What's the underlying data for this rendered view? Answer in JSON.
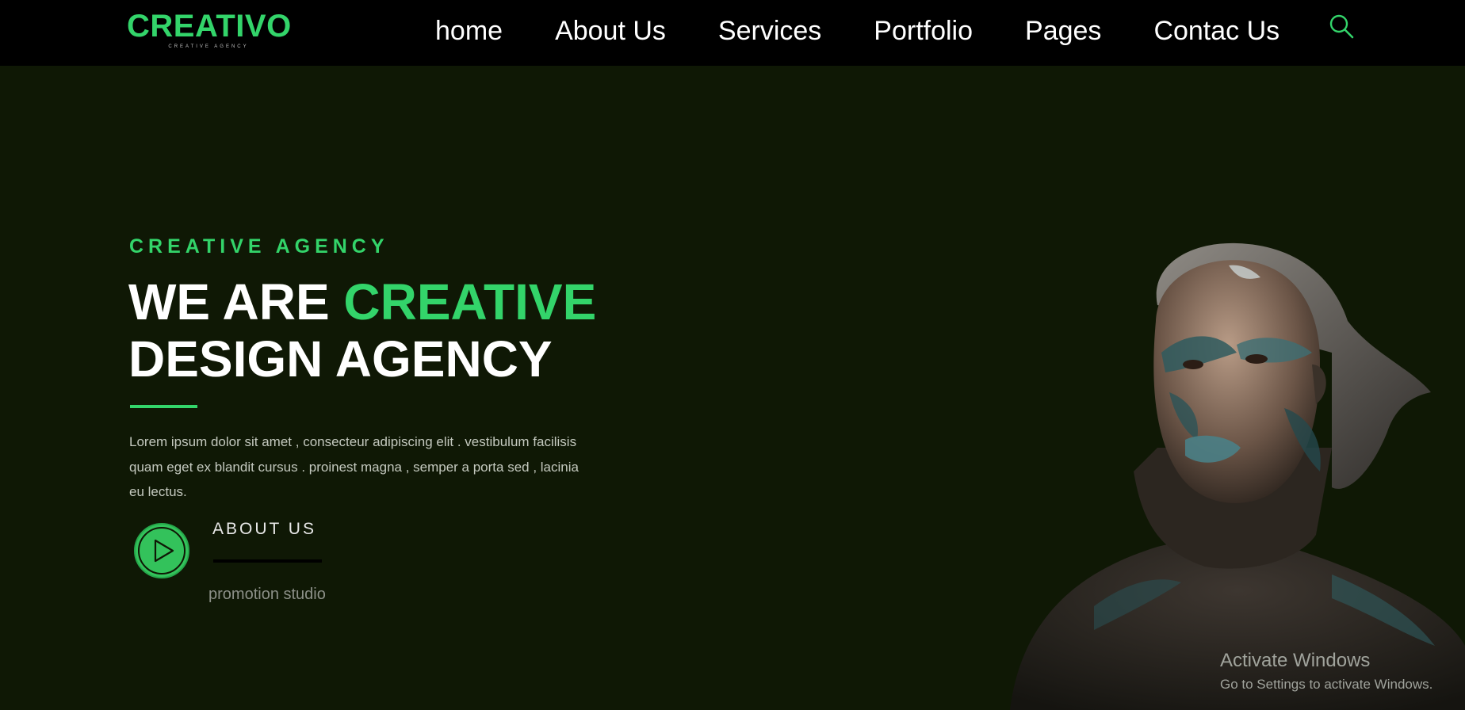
{
  "brand": {
    "name": "CREATIVO",
    "tagline": "CREATIVE AGENCY",
    "accent_color": "#33d46a",
    "background_color": "#0f1805",
    "nav_background": "#000000"
  },
  "nav": {
    "items": [
      {
        "label": "home"
      },
      {
        "label": "About Us"
      },
      {
        "label": "Services"
      },
      {
        "label": "Portfolio"
      },
      {
        "label": "Pages"
      },
      {
        "label": "Contac Us"
      }
    ],
    "search_icon": "search-icon"
  },
  "hero": {
    "eyebrow": "CREATIVE AGENCY",
    "headline_part1": "WE ARE ",
    "headline_accent": "CREATIVE",
    "headline_line2": "DESIGN AGENCY",
    "body": "Lorem ipsum dolor sit amet , consecteur adipiscing elit . vestibulum facilisis quam eget ex blandit cursus . proinest magna , semper a porta sed , lacinia eu lectus.",
    "play_icon": "play-icon",
    "cta_label": "ABOUT US",
    "cta_caption": "promotion studio",
    "image": "face-painted-woman-portrait"
  },
  "watermark": {
    "title": "Activate Windows",
    "subtitle": "Go to Settings to activate Windows."
  }
}
